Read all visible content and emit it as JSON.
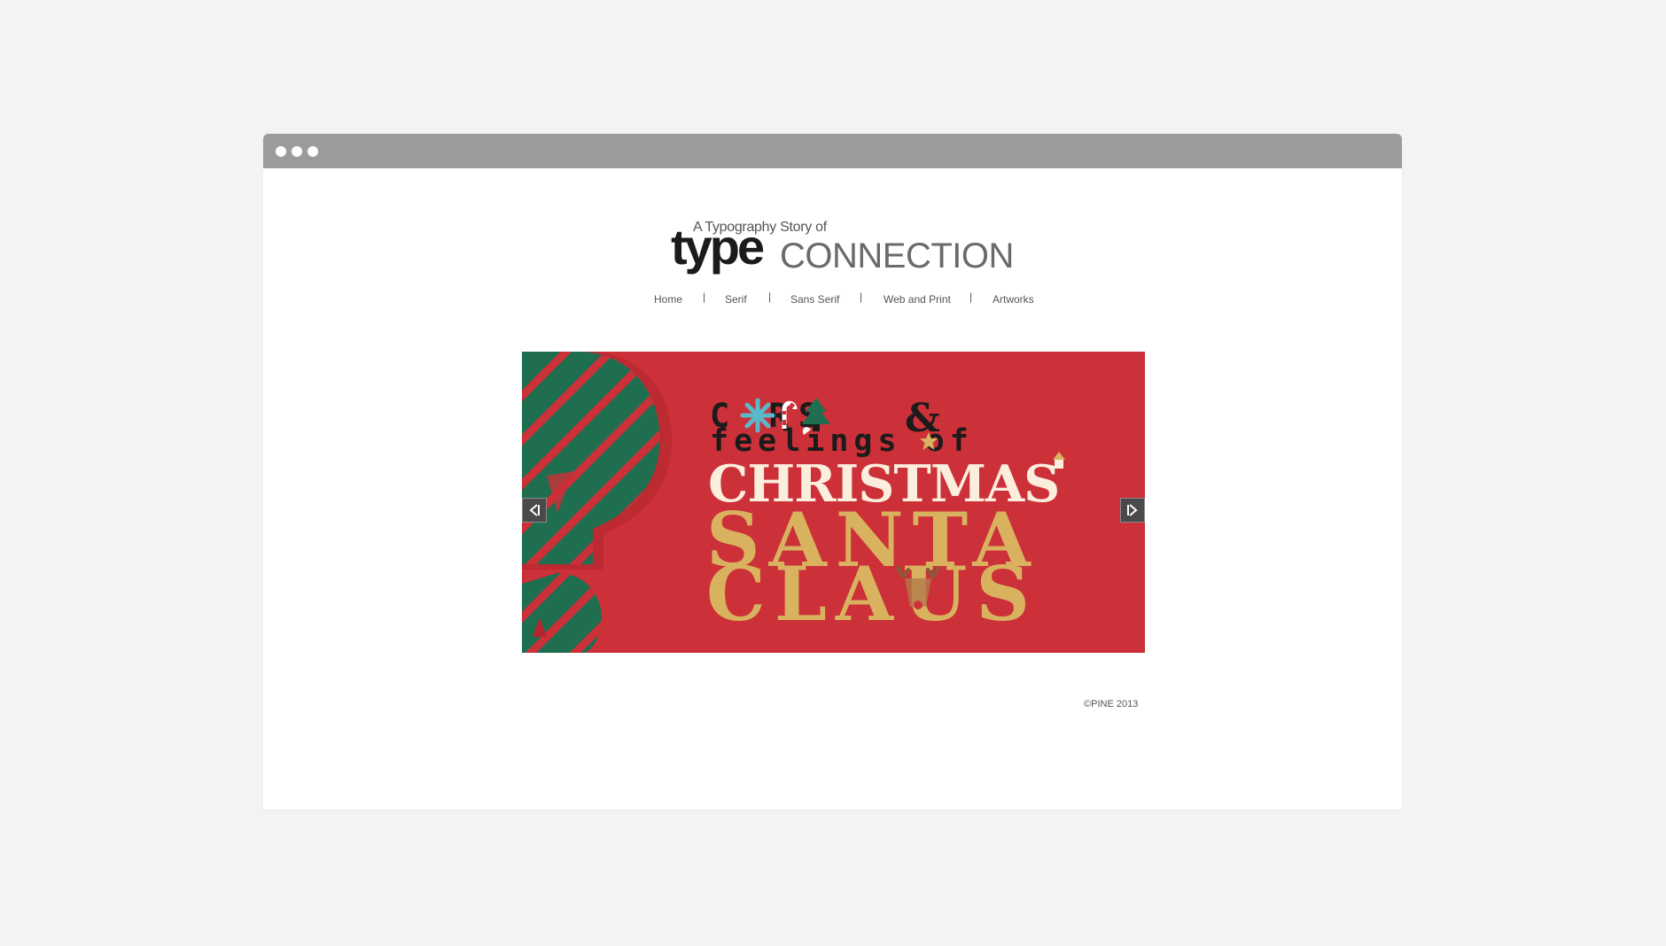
{
  "window": {
    "dots": [
      "dot",
      "dot",
      "dot"
    ]
  },
  "logo": {
    "tagline": "A Typography Story of",
    "word_type": "type",
    "word_connection": "CONNECTION"
  },
  "nav": {
    "items": [
      "Home",
      "Serif",
      "Sans Serif",
      "Web and Print",
      "Artworks"
    ],
    "separator": "|"
  },
  "slider": {
    "lines": {
      "colors": "C    RS",
      "feelings": "feelings  of",
      "christmas": "CHRISTMAS",
      "santa": "SANTA",
      "claus": "CLAUS"
    },
    "prev_icon": "arrow-left-icon",
    "next_icon": "arrow-right-icon"
  },
  "footer": {
    "copyright": "©PINE 2013"
  },
  "colors": {
    "background": "#f3f3f3",
    "titlebar": "#9b9b9b",
    "slide_red": "#cc3038",
    "slide_green": "#1f6e50",
    "gold": "#d9b25f",
    "cream": "#fbeedd"
  }
}
